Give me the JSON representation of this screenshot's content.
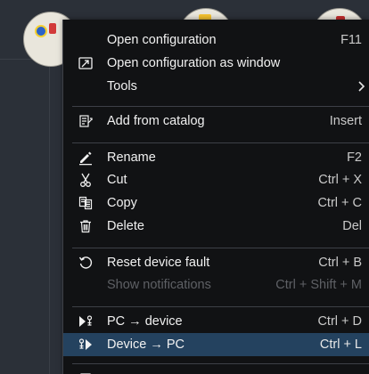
{
  "context_menu": {
    "items": [
      {
        "label": "Open configuration",
        "shortcut": "F11",
        "icon": "",
        "enabled": true
      },
      {
        "label": "Open configuration as window",
        "shortcut": "",
        "icon": "open-window-icon",
        "enabled": true
      },
      {
        "label": "Tools",
        "shortcut": "",
        "icon": "",
        "enabled": true,
        "submenu": true
      },
      {
        "label": "Add from catalog",
        "shortcut": "Insert",
        "icon": "catalog-add-icon",
        "enabled": true
      },
      {
        "label": "Rename",
        "shortcut": "F2",
        "icon": "pencil-icon",
        "enabled": true
      },
      {
        "label": "Cut",
        "shortcut": "Ctrl + X",
        "icon": "scissors-icon",
        "enabled": true
      },
      {
        "label": "Copy",
        "shortcut": "Ctrl + C",
        "icon": "copy-icon",
        "enabled": true
      },
      {
        "label": "Delete",
        "shortcut": "Del",
        "icon": "trash-icon",
        "enabled": true
      },
      {
        "label": "Reset device fault",
        "shortcut": "Ctrl + B",
        "icon": "reset-icon",
        "enabled": true
      },
      {
        "label": "Show notifications",
        "shortcut": "Ctrl + Shift + M",
        "icon": "",
        "enabled": false
      },
      {
        "label": "PC → device",
        "shortcut": "Ctrl + D",
        "icon": "pc-to-device-icon",
        "enabled": true
      },
      {
        "label": "Device → PC",
        "shortcut": "Ctrl + L",
        "icon": "device-to-pc-icon",
        "enabled": true,
        "highlighted": true
      }
    ]
  },
  "colors": {
    "menu_background": "#111214",
    "highlight": "#24425f",
    "canvas_background": "#2b3038",
    "disabled_text": "#5e6065"
  }
}
